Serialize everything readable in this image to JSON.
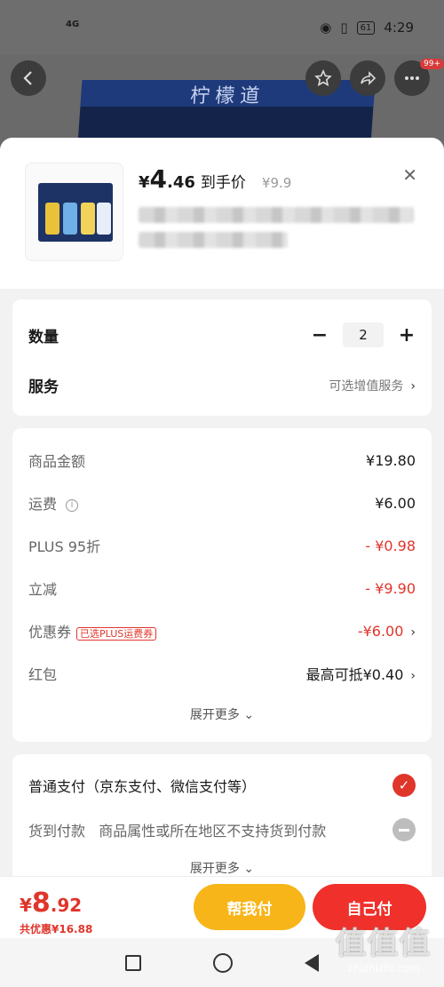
{
  "status_bar": {
    "signal": "4G",
    "battery": "61",
    "time": "4:29"
  },
  "header": {
    "message_badge": "99+",
    "product_box_text": "柠檬道"
  },
  "sheet": {
    "price": {
      "currency": "¥",
      "integer": "4",
      "decimal": ".46",
      "tag": "到手价",
      "original": "¥9.9"
    },
    "close_icon": "close-icon"
  },
  "options": {
    "quantity_label": "数量",
    "quantity_value": "2",
    "minus": "−",
    "plus": "+",
    "service_label": "服务",
    "service_hint": "可选增值服务"
  },
  "costs": {
    "items": [
      {
        "label": "商品金额",
        "value": "¥19.80",
        "red": false
      },
      {
        "label": "运费",
        "value": "¥6.00",
        "red": false
      },
      {
        "label": "PLUS 95折",
        "value": "- ¥0.98",
        "red": true
      },
      {
        "label": "立减",
        "value": "- ¥9.90",
        "red": true
      }
    ],
    "coupon_label": "优惠券",
    "coupon_badge": "已选PLUS运费券",
    "coupon_value": "-¥6.00",
    "redpacket_label": "红包",
    "redpacket_value": "最高可抵¥0.40",
    "expand_more": "展开更多"
  },
  "payment": {
    "normal_label": "普通支付（京东支付、微信支付等）",
    "cod_label": "货到付款",
    "cod_note": "商品属性或所在地区不支持货到付款",
    "expand_more": "展开更多"
  },
  "bottom": {
    "currency": "¥",
    "total_integer": "8",
    "total_decimal": ".92",
    "saving": "共优惠¥16.88",
    "help_pay": "帮我付",
    "self_pay": "自己付"
  },
  "watermark": {
    "logo": "值值值",
    "url": "zhizhizhi.com"
  },
  "colors": {
    "accent_red": "#e0352b",
    "help_button": "#f7b519",
    "self_button": "#f0302a"
  }
}
